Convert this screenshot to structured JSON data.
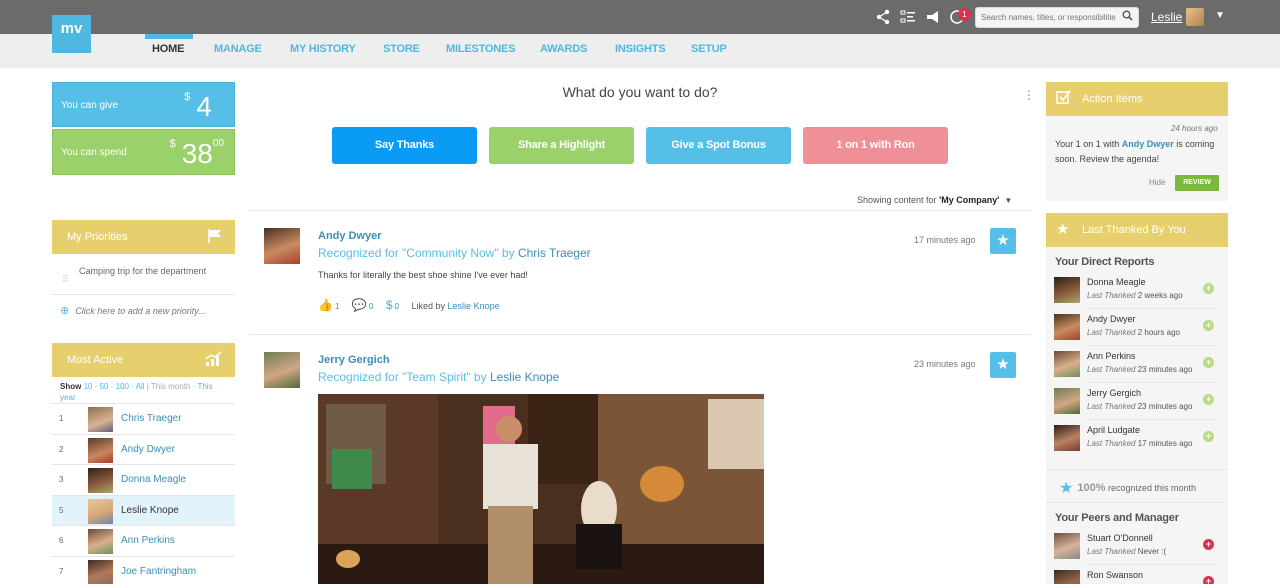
{
  "brand": {
    "logo_text": "mv"
  },
  "topbar": {
    "icons": [
      "share-icon",
      "checklist-icon",
      "megaphone-icon",
      "notifications-icon"
    ],
    "notification_count": "1",
    "search_placeholder": "Search names, titles, or responsibilities",
    "user_name": "Leslie"
  },
  "nav": {
    "tabs": [
      "HOME",
      "MANAGE",
      "MY HISTORY",
      "STORE",
      "MILESTONES",
      "AWARDS",
      "INSIGHTS",
      "SETUP"
    ],
    "active": "HOME"
  },
  "wallet": {
    "give_label": "You can give",
    "give_currency": "$",
    "give_amount": "4",
    "spend_label": "You can spend",
    "spend_currency": "$",
    "spend_amount": "38",
    "spend_cents": "00"
  },
  "priorities": {
    "title": "My Priorities",
    "items": [
      "Camping trip for the department"
    ],
    "add_placeholder": "Click here to add a new priority..."
  },
  "most_active": {
    "title": "Most Active",
    "show_label": "Show",
    "options": [
      "10",
      "50",
      "100",
      "All",
      "This month",
      "This year"
    ],
    "rows": [
      {
        "rank": "1",
        "name": "Chris Traeger"
      },
      {
        "rank": "2",
        "name": "Andy Dwyer"
      },
      {
        "rank": "3",
        "name": "Donna Meagle"
      },
      {
        "rank": "5",
        "name": "Leslie Knope",
        "highlight": true
      },
      {
        "rank": "6",
        "name": "Ann Perkins"
      },
      {
        "rank": "7",
        "name": "Joe Fantringham"
      }
    ]
  },
  "center": {
    "question": "What do you want to do?",
    "buttons": [
      {
        "label": "Say Thanks",
        "color": "#0a9cf5"
      },
      {
        "label": "Share a Highlight",
        "color": "#9bd16a"
      },
      {
        "label": "Give a Spot Bonus",
        "color": "#56bfe8"
      },
      {
        "label": "1 on 1 with Ron",
        "color": "#ef8f98"
      }
    ],
    "showing_prefix": "Showing content for",
    "showing_value": "'My Company'"
  },
  "feed": [
    {
      "name": "Andy Dwyer",
      "recognized_prefix": "Recognized for \"Community Now\" by",
      "recognized_by": "Chris Traeger",
      "time": "17 minutes ago",
      "message": "Thanks for literally the best shoe shine I've ever had!",
      "likes": "1",
      "comments": "0",
      "bonus": "0",
      "liked_by_label": "Liked by",
      "liked_by": "Leslie Knope"
    },
    {
      "name": "Jerry Gergich",
      "recognized_prefix": "Recognized for \"Team Spirit\" by",
      "recognized_by": "Leslie Knope",
      "time": "23 minutes ago"
    }
  ],
  "action_items": {
    "title": "Action Items",
    "time": "24 hours ago",
    "text_before": "Your 1 on 1 with",
    "text_person": "Andy Dwyer",
    "text_after": "is coming soon. Review the agenda!",
    "hide_label": "Hide",
    "review_label": "REVIEW"
  },
  "last_thanked": {
    "title": "Last Thanked By You",
    "direct_reports_title": "Your Direct Reports",
    "last_thanked_label": "Last Thanked",
    "direct_reports": [
      {
        "name": "Donna Meagle",
        "when": "2 weeks ago"
      },
      {
        "name": "Andy Dwyer",
        "when": "2 hours ago"
      },
      {
        "name": "Ann Perkins",
        "when": "23 minutes ago"
      },
      {
        "name": "Jerry Gergich",
        "when": "23 minutes ago"
      },
      {
        "name": "April Ludgate",
        "when": "17 minutes ago"
      }
    ],
    "percent": "100%",
    "percent_label": "recognized this month",
    "peers_title": "Your Peers and Manager",
    "peers": [
      {
        "name": "Stuart O'Donnell",
        "when": "Never :("
      },
      {
        "name": "Ron Swanson",
        "when": ""
      }
    ]
  },
  "colors": {
    "accent_blue": "#4fb8e1",
    "highlight_yellow": "#e8cf6e",
    "give_blue": "#56bfe8",
    "spend_green": "#9bd16a",
    "review_green": "#7ab83e",
    "alert_red": "#d9334d"
  }
}
